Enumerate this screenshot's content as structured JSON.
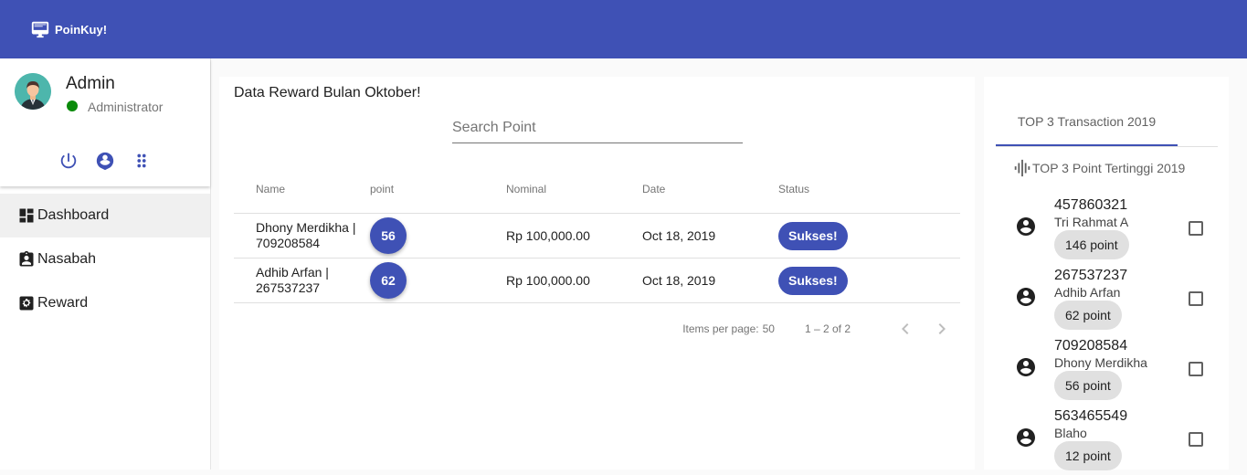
{
  "app": {
    "brand": "PoinKuy!"
  },
  "profile": {
    "name": "Admin",
    "role": "Administrator"
  },
  "nav": [
    {
      "label": "Dashboard"
    },
    {
      "label": "Nasabah"
    },
    {
      "label": "Reward"
    }
  ],
  "main": {
    "title": "Data Reward Bulan Oktober!",
    "search_placeholder": "Search Point",
    "columns": {
      "name": "Name",
      "point": "point",
      "nominal": "Nominal",
      "date": "Date",
      "status": "Status"
    },
    "rows": [
      {
        "name": "Dhony Merdikha | 709208584",
        "point": "56",
        "nominal": "Rp 100,000.00",
        "date": "Oct 18, 2019",
        "status": "Sukses!"
      },
      {
        "name": "Adhib Arfan | 267537237",
        "point": "62",
        "nominal": "Rp 100,000.00",
        "date": "Oct 18, 2019",
        "status": "Sukses!"
      }
    ],
    "paginator": {
      "items_label": "Items per page:",
      "page_size": "50",
      "range": "1 – 2 of 2"
    }
  },
  "side": {
    "tab_label": "TOP 3 Transaction 2019",
    "subheading": "TOP 3 Point Tertinggi 2019",
    "items": [
      {
        "account": "457860321",
        "name": "Tri Rahmat A",
        "points": "146 point"
      },
      {
        "account": "267537237",
        "name": "Adhib Arfan",
        "points": "62 point"
      },
      {
        "account": "709208584",
        "name": "Dhony Merdikha",
        "points": "56 point"
      },
      {
        "account": "563465549",
        "name": "Blaho",
        "points": "12 point"
      }
    ]
  },
  "colors": {
    "primary": "#3f51b5",
    "online": "#0a8a0a",
    "chip_bg": "#e0e0e0"
  }
}
